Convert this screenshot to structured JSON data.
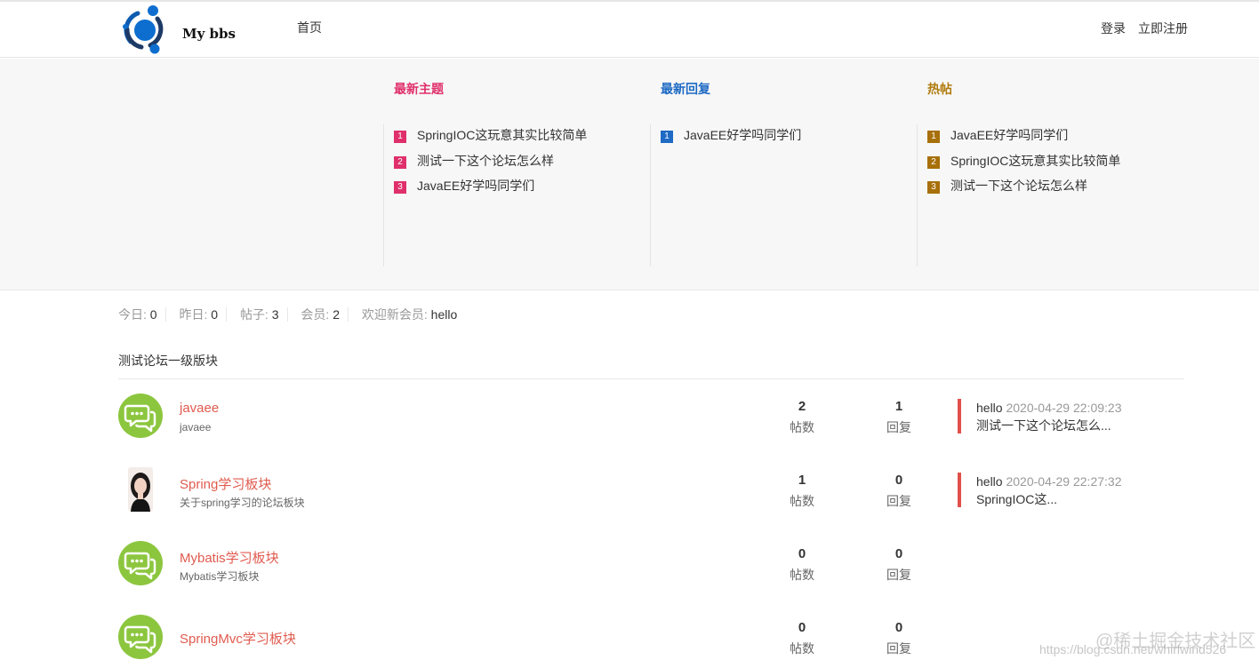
{
  "header": {
    "logo_text": "My bbs",
    "nav_home": "首页",
    "login": "登录",
    "register": "立即注册"
  },
  "panel": {
    "latest_topics": {
      "title": "最新主题",
      "items": [
        {
          "num": "1",
          "text": "SpringIOC这玩意其实比较简单"
        },
        {
          "num": "2",
          "text": "测试一下这个论坛怎么样"
        },
        {
          "num": "3",
          "text": "JavaEE好学吗同学们"
        }
      ]
    },
    "latest_replies": {
      "title": "最新回复",
      "items": [
        {
          "num": "1",
          "text": "JavaEE好学吗同学们"
        }
      ]
    },
    "hot_posts": {
      "title": "热帖",
      "items": [
        {
          "num": "1",
          "text": "JavaEE好学吗同学们"
        },
        {
          "num": "2",
          "text": "SpringIOC这玩意其实比较简单"
        },
        {
          "num": "3",
          "text": "测试一下这个论坛怎么样"
        }
      ]
    },
    "colors": {
      "topics": "#e0306b",
      "replies": "#1e6ac4",
      "hot": "#a8700a"
    }
  },
  "stats": {
    "today_label": "今日:",
    "today": "0",
    "yesterday_label": "昨日:",
    "yesterday": "0",
    "posts_label": "帖子:",
    "posts": "3",
    "members_label": "会员:",
    "members": "2",
    "welcome_label": "欢迎新会员:",
    "welcome_user": "hello"
  },
  "section": {
    "title": "测试论坛一级版块",
    "posts_label": "帖数",
    "replies_label": "回复",
    "forums": [
      {
        "name": "javaee",
        "desc": "javaee",
        "avatar": "chat-bubble-icon",
        "posts": "2",
        "replies": "1",
        "last_user": "hello",
        "last_time": "2020-04-29 22:09:23",
        "last_subject": "测试一下这个论坛怎么..."
      },
      {
        "name": "Spring学习板块",
        "desc": "关于spring学习的论坛板块",
        "avatar": "user-photo",
        "posts": "1",
        "replies": "0",
        "last_user": "hello",
        "last_time": "2020-04-29 22:27:32",
        "last_subject": "SpringIOC这..."
      },
      {
        "name": "Mybatis学习板块",
        "desc": "Mybatis学习板块",
        "avatar": "chat-bubble-icon",
        "posts": "0",
        "replies": "0"
      },
      {
        "name": "SpringMvc学习板块",
        "desc": "",
        "avatar": "chat-bubble-icon",
        "posts": "0",
        "replies": "0"
      }
    ]
  },
  "watermark": {
    "url": "https://blog.csdn.net/whirlwind526",
    "community": "@稀土掘金技术社区"
  }
}
